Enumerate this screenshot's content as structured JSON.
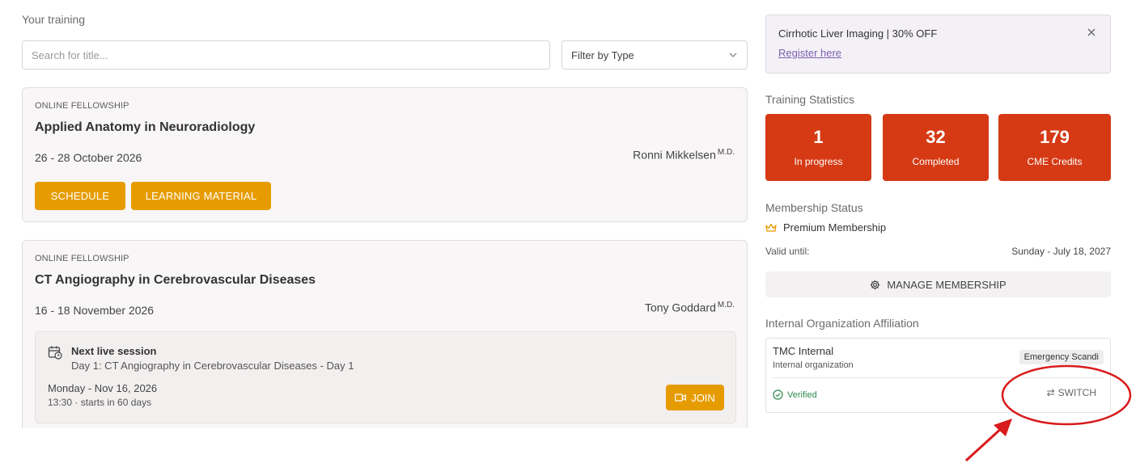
{
  "training": {
    "title": "Your training",
    "search_placeholder": "Search for title...",
    "filter_label": "Filter by Type",
    "courses": [
      {
        "type": "ONLINE FELLOWSHIP",
        "title": "Applied Anatomy in Neuroradiology",
        "dates": "26 - 28 October 2026",
        "instructor": "Ronni Mikkelsen",
        "instructor_suffix": "M.D.",
        "buttons": [
          "SCHEDULE",
          "LEARNING MATERIAL"
        ]
      },
      {
        "type": "ONLINE FELLOWSHIP",
        "title": "CT Angiography in Cerebrovascular Diseases",
        "dates": "16 - 18 November 2026",
        "instructor": "Tony Goddard",
        "instructor_suffix": "M.D.",
        "session": {
          "label": "Next live session",
          "name": "Day 1: CT Angiography in Cerebrovascular Diseases - Day 1",
          "day": "Monday - Nov 16, 2026",
          "time": "13:30 · starts in 60 days",
          "join_label": "JOIN"
        }
      }
    ]
  },
  "promo": {
    "title": "Cirrhotic Liver Imaging | 30% OFF",
    "link": "Register here"
  },
  "stats": {
    "title": "Training Statistics",
    "items": [
      {
        "value": "1",
        "label": "In progress"
      },
      {
        "value": "32",
        "label": "Completed"
      },
      {
        "value": "179",
        "label": "CME Credits"
      }
    ]
  },
  "membership": {
    "title": "Membership Status",
    "type": "Premium Membership",
    "valid_label": "Valid until:",
    "valid_value": "Sunday - July 18, 2027",
    "manage_label": "MANAGE MEMBERSHIP"
  },
  "affiliation": {
    "title": "Internal Organization Affiliation",
    "org_name": "TMC Internal",
    "org_type": "Internal organization",
    "tag": "Emergency Scandi",
    "verified": "Verified",
    "switch_label": "SWITCH"
  },
  "colors": {
    "accent_yellow": "#e69c00",
    "stat_red": "#d53a14",
    "annotation_red": "#d81b1b",
    "link_purple": "#7b5fb0",
    "verified_green": "#2e8a4e"
  }
}
